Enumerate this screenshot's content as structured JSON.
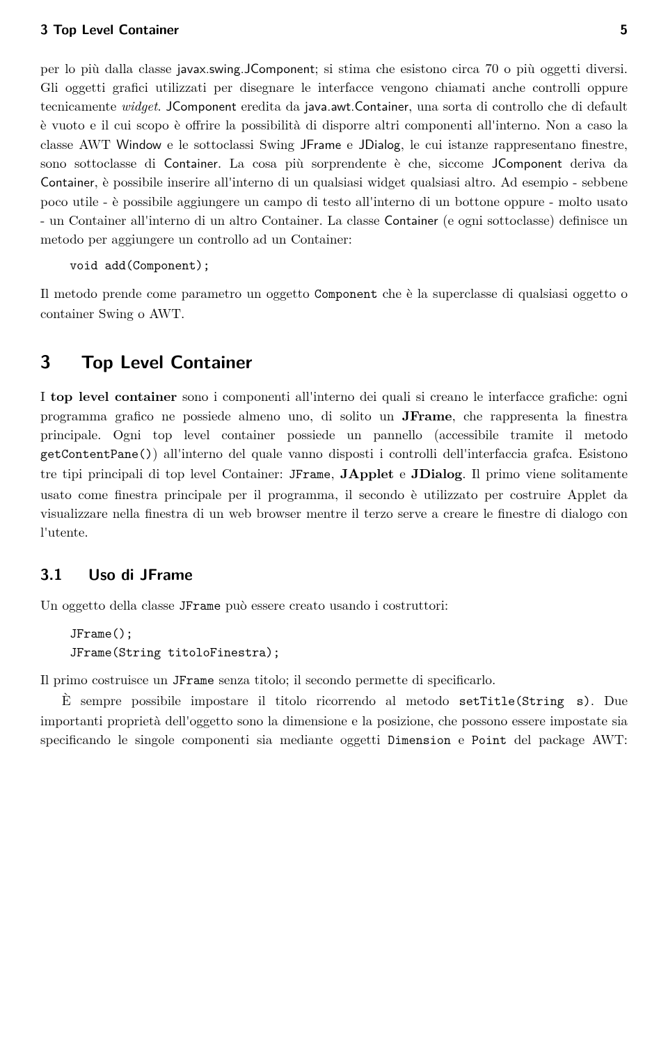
{
  "header": {
    "running_title": "3 Top Level Container",
    "page_number": "5"
  },
  "para1": {
    "t1": "per lo più dalla classe ",
    "c1": "javax.swing.JComponent",
    "t2": "; si stima che esistono circa 70 o più oggetti diversi. Gli oggetti grafici utilizzati per disegnare le interfacce vengono chiamati anche controlli oppure tecnicamente ",
    "i1": "widget",
    "t3": ". ",
    "c2": "JComponent",
    "t4": " eredita da ",
    "c3": "java.awt.Container",
    "t5": ", una sorta di controllo che di default è vuoto e il cui scopo è offrire la possibilità di disporre altri componenti all'interno. Non a caso la classe AWT ",
    "c4": "Window",
    "t6": " e le sottoclassi Swing ",
    "c5": "JFrame",
    "t7": " e ",
    "c6": "JDialog",
    "t8": ", le cui istanze rappresentano finestre, sono sottoclasse di ",
    "c7": "Container",
    "t9": ". La cosa più sorprendente è che, siccome ",
    "c8": "JComponent",
    "t10": " deriva da ",
    "c9": "Container",
    "t11": ", è possibile inserire all'interno di un qualsiasi widget qualsiasi altro. Ad esempio - sebbene poco utile - è possibile aggiungere un campo di testo all'interno di un bottone oppure - molto usato - un Container all'interno di un altro Container. La classe ",
    "c10": "Container",
    "t12": " (e ogni sottoclasse) definisce un metodo per aggiungere un controllo ad un Container:"
  },
  "code1": "void add(Component);",
  "para2": {
    "t1": "Il metodo prende come parametro un oggetto ",
    "c1": "Component",
    "t2": " che è la superclasse di qualsiasi oggetto o container Swing o AWT."
  },
  "sec3": {
    "num": "3",
    "title": "Top Level Container"
  },
  "para3": {
    "t1": "I ",
    "b1": "top level container",
    "t2": " sono i componenti all'interno dei quali si creano le interfacce grafiche: ogni programma grafico ne possiede almeno uno, di solito un ",
    "b2": "JFrame",
    "t3": ", che rappresenta la finestra principale. Ogni top level container possiede un pannello (accessibile tramite il metodo ",
    "c1": "getContentPane()",
    "t4": ") all'interno del quale vanno disposti i controlli dell'interfaccia grafca. Esistono tre tipi principali di top level Container: ",
    "c2": "JFrame",
    "t5": ", ",
    "b3": "JApplet",
    "t6": " e ",
    "b4": "JDialog",
    "t7": ". Il primo viene solitamente usato come finestra principale per il programma, il secondo è utilizzato per costruire Applet da visualizzare nella finestra di un web browser mentre il terzo serve a creare le finestre di dialogo con l'utente."
  },
  "sec31": {
    "num": "3.1",
    "title": "Uso di JFrame"
  },
  "para4": {
    "t1": "Un oggetto della classe ",
    "c1": "JFrame",
    "t2": " può essere creato usando i costruttori:"
  },
  "code2a": "JFrame();",
  "code2b": "JFrame(String titoloFinestra);",
  "para5": {
    "t1": "Il primo costruisce un ",
    "c1": "JFrame",
    "t2": " senza titolo; il secondo permette di specificarlo."
  },
  "para6": {
    "t1": "È sempre possibile impostare il titolo ricorrendo al metodo ",
    "c1": "setTitle(String s)",
    "t2": ". Due importanti proprietà dell'oggetto sono la dimensione e la posizione, che possono essere impostate sia specificando le singole componenti sia mediante oggetti ",
    "c2": "Dimension",
    "t3": " e ",
    "c3": "Point",
    "t4": " del package AWT:"
  }
}
